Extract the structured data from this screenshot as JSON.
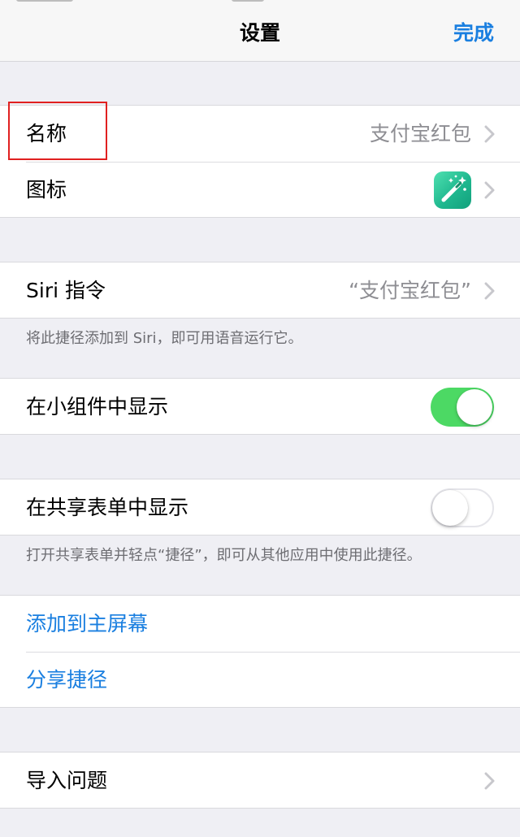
{
  "navbar": {
    "title": "设置",
    "done_label": "完成"
  },
  "group_name_icon": {
    "name_label": "名称",
    "name_value": "支付宝红包",
    "icon_label": "图标",
    "icon_name": "magic-wand-icon",
    "icon_gradient": [
      "#4fe0b0",
      "#12a07c"
    ]
  },
  "group_siri": {
    "siri_label": "Siri 指令",
    "siri_value": "“支付宝红包”",
    "footnote": "将此捷径添加到 Siri，即可用语音运行它。"
  },
  "group_widget": {
    "label": "在小组件中显示",
    "enabled": true
  },
  "group_share": {
    "label": "在共享表单中显示",
    "enabled": false,
    "footnote": "打开共享表单并轻点“捷径”，即可从其他应用中使用此捷径。"
  },
  "group_actions": {
    "add_home": "添加到主屏幕",
    "share": "分享捷径"
  },
  "group_import": {
    "label": "导入问题"
  },
  "colors": {
    "accent": "#1a7fe0",
    "toggle_on": "#4cd964",
    "highlight": "#e02020",
    "background": "#efeff4"
  }
}
